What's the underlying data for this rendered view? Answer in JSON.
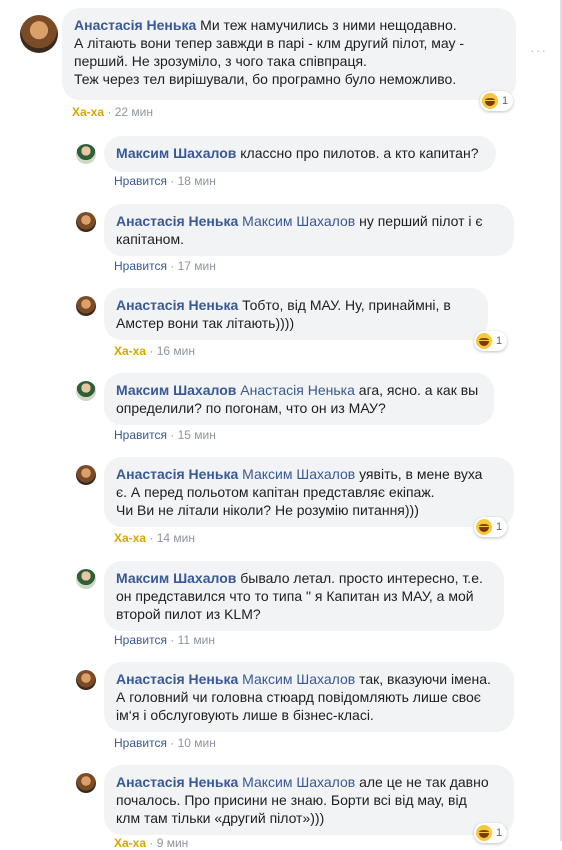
{
  "comments": [
    {
      "author": "Анастасія Ненька",
      "mention": "",
      "lines": [
        "Ми теж намучились з ними нещодавно.",
        "А літають вони тепер завжди в парі - клм другий пілот, мау -",
        "перший. Не зрозуміло, з чого така співпраця.",
        "Теж через тел вирішували, бо програмно було неможливо."
      ],
      "action": "Ха-ха",
      "time": "22 мин",
      "reaction_count": "1"
    },
    {
      "author": "Максим Шахалов",
      "mention": "",
      "lines": [
        "классно про пилотов. а кто капитан?"
      ],
      "action": "Нравится",
      "time": "18 мин",
      "reaction_count": ""
    },
    {
      "author": "Анастасія Ненька",
      "mention": "Максим Шахалов",
      "lines": [
        "ну перший пілот і є",
        "капітаном."
      ],
      "action": "Нравится",
      "time": "17 мин",
      "reaction_count": ""
    },
    {
      "author": "Анастасія Ненька",
      "mention": "",
      "lines": [
        "Тобто, від МАУ. Ну, принаймні, в",
        "Амстер вони так літають))))"
      ],
      "action": "Ха-ха",
      "time": "16 мин",
      "reaction_count": "1"
    },
    {
      "author": "Максим Шахалов",
      "mention": "Анастасія Ненька",
      "lines": [
        "ага, ясно. а как вы",
        "определили? по погонам, что он из МАУ?"
      ],
      "action": "Нравится",
      "time": "15 мин",
      "reaction_count": ""
    },
    {
      "author": "Анастасія Ненька",
      "mention": "Максим Шахалов",
      "lines": [
        "уявіть, в мене вуха",
        "є. А перед польотом капітан представляє екіпаж.",
        "Чи Ви не літали ніколи? Не розумію питання)))"
      ],
      "action": "Ха-ха",
      "time": "14 мин",
      "reaction_count": "1"
    },
    {
      "author": "Максим Шахалов",
      "mention": "",
      "lines": [
        "бывало летал. просто интересно, т.е.",
        "он представился что то типа \" я Капитан из МАУ, а мой",
        "второй пилот из KLM?"
      ],
      "action": "Нравится",
      "time": "11 мин",
      "reaction_count": ""
    },
    {
      "author": "Анастасія Ненька",
      "mention": "Максим Шахалов",
      "lines": [
        "так, вказуючи імена.",
        "А головний чи головна стюард повідомляють лише своє",
        "ім‘я і обслуговують лише в бізнес-класі."
      ],
      "action": "Нравится",
      "time": "10 мин",
      "reaction_count": ""
    },
    {
      "author": "Анастасія Ненька",
      "mention": "Максим Шахалов",
      "lines": [
        "але це не так давно",
        "почалось. Про присини не знаю. Борти всі від мау, від",
        "клм там тільки «другий пілот»)))"
      ],
      "action": "Ха-ха",
      "time": "9 мин",
      "reaction_count": "1"
    }
  ]
}
